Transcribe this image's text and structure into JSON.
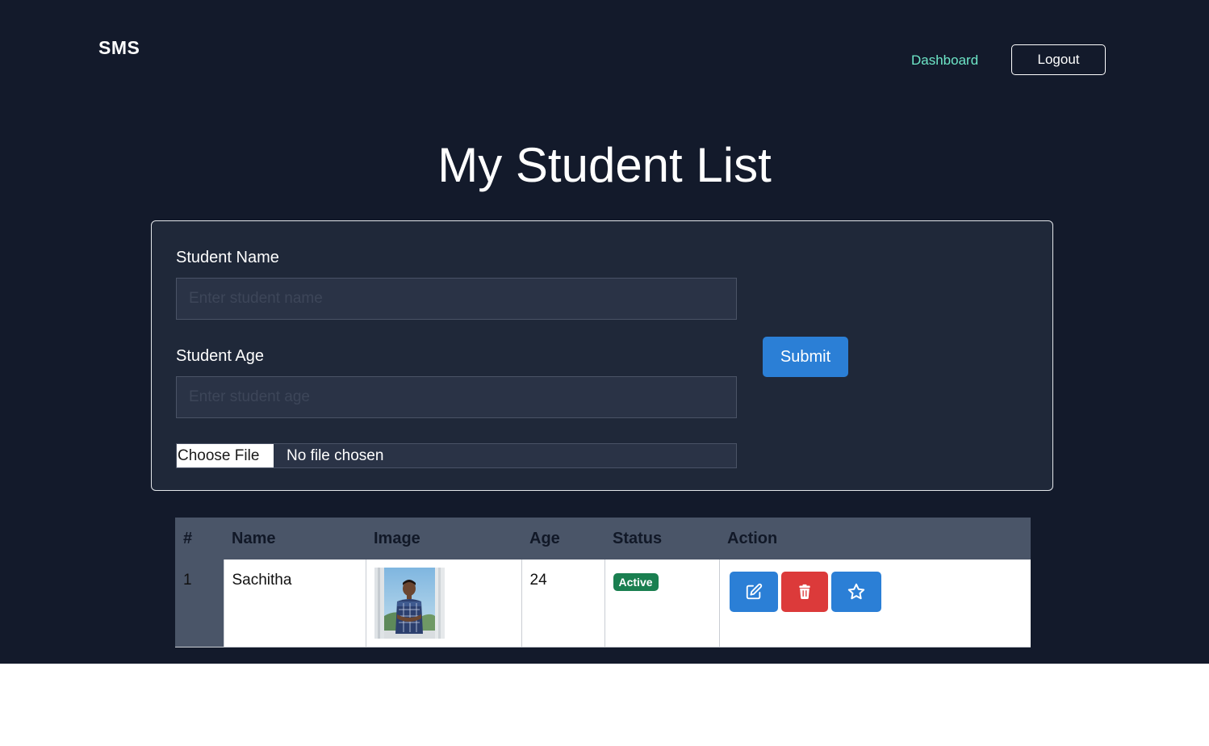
{
  "header": {
    "brand": "SMS",
    "nav_dashboard": "Dashboard",
    "logout_label": "Logout"
  },
  "page": {
    "title": "My Student List"
  },
  "form": {
    "name_label": "Student Name",
    "name_placeholder": "Enter student name",
    "name_value": "",
    "age_label": "Student Age",
    "age_placeholder": "Enter student age",
    "age_value": "",
    "file_button": "Choose File",
    "file_status": "No file chosen",
    "submit_label": "Submit"
  },
  "table": {
    "columns": [
      "#",
      "Name",
      "Image",
      "Age",
      "Status",
      "Action"
    ],
    "rows": [
      {
        "index": "1",
        "name": "Sachitha",
        "age": "24",
        "status": "Active"
      }
    ]
  },
  "icons": {
    "edit": "edit-icon",
    "delete": "trash-icon",
    "favorite": "star-icon"
  },
  "colors": {
    "background": "#131a2b",
    "card": "#1f2839",
    "accent_blue": "#2b7fd6",
    "danger_red": "#dc3a3a",
    "status_green": "#1a7f50",
    "nav_link": "#6ee7c8"
  }
}
